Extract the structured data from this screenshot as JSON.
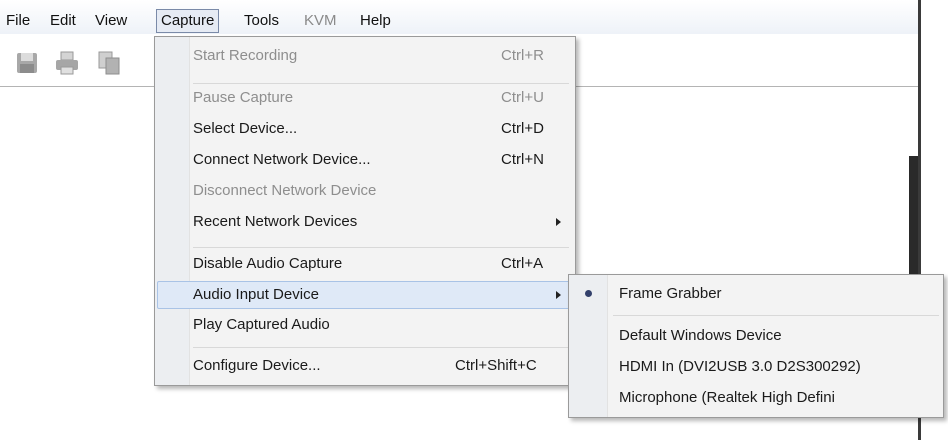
{
  "menubar": {
    "file": "File",
    "edit": "Edit",
    "view": "View",
    "capture": "Capture",
    "tools": "Tools",
    "kvm": "KVM",
    "help": "Help"
  },
  "toolbar": {
    "icons": [
      "save-icon",
      "print-icon",
      "copy-icon"
    ]
  },
  "capture_menu": {
    "start_recording": {
      "label": "Start Recording",
      "shortcut": "Ctrl+R"
    },
    "pause_capture": {
      "label": "Pause Capture",
      "shortcut": "Ctrl+U"
    },
    "select_device": {
      "label": "Select Device...",
      "shortcut": "Ctrl+D"
    },
    "connect_network_device": {
      "label": "Connect Network Device...",
      "shortcut": "Ctrl+N"
    },
    "disconnect_network_device": {
      "label": "Disconnect Network Device"
    },
    "recent_network_devices": {
      "label": "Recent Network Devices"
    },
    "disable_audio_capture": {
      "label": "Disable Audio Capture",
      "shortcut": "Ctrl+A"
    },
    "audio_input_device": {
      "label": "Audio Input Device"
    },
    "play_captured_audio": {
      "label": "Play Captured Audio"
    },
    "configure_device": {
      "label": "Configure Device...",
      "shortcut": "Ctrl+Shift+C"
    }
  },
  "audio_submenu": {
    "frame_grabber": "Frame Grabber",
    "default_windows_device": "Default Windows Device",
    "hdmi_in": "HDMI In (DVI2USB 3.0 D2S300292)",
    "microphone": "Microphone (Realtek High Defini"
  },
  "colors": {
    "highlight": "#dfe9f7",
    "disabled_text": "#8e8e8e",
    "bullet": "#33406b"
  }
}
